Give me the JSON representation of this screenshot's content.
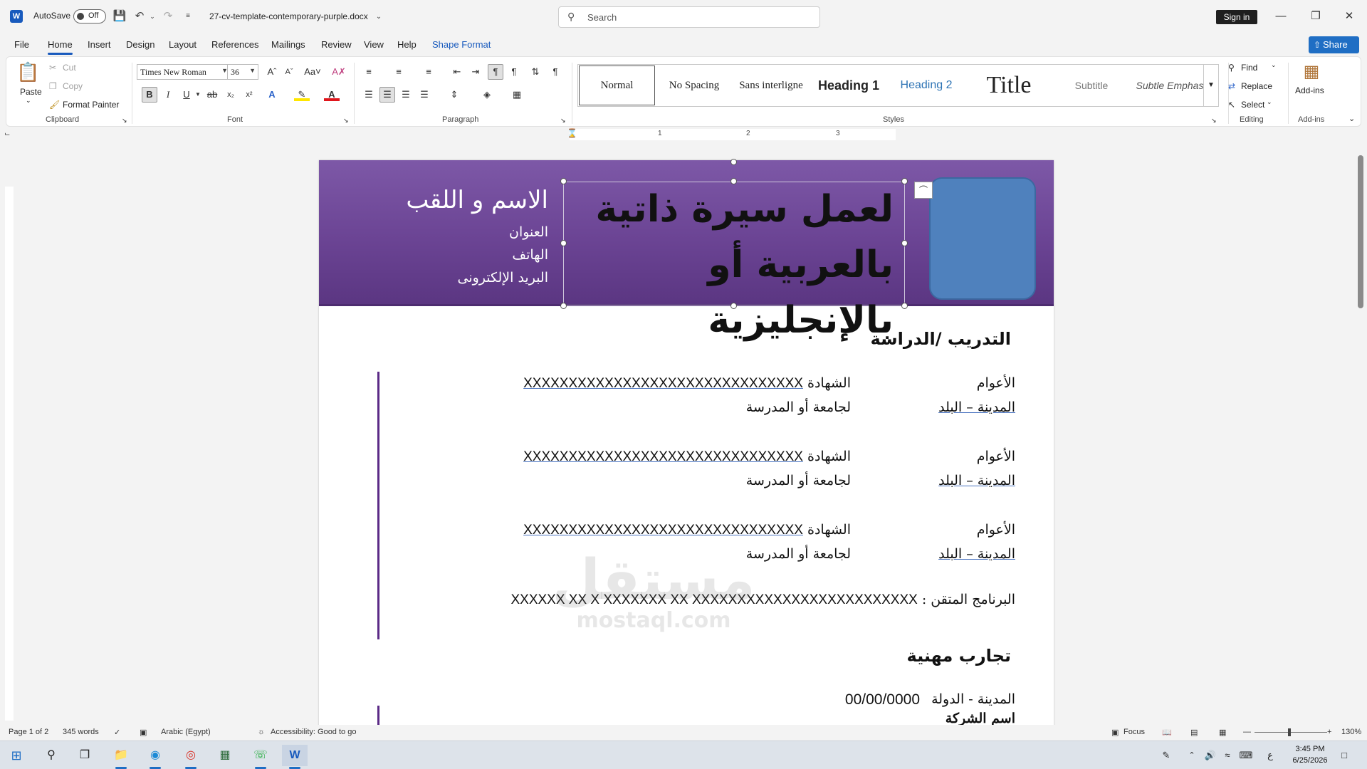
{
  "titlebar": {
    "autosave_label": "AutoSave",
    "autosave_state": "Off",
    "doc_title": "27-cv-template-contemporary-purple.docx",
    "search_placeholder": "Search",
    "signin": "Sign in"
  },
  "menu": [
    "File",
    "Home",
    "Insert",
    "Design",
    "Layout",
    "References",
    "Mailings",
    "Review",
    "View",
    "Help",
    "Shape Format"
  ],
  "share_label": "Share",
  "ribbon": {
    "clipboard": {
      "paste": "Paste",
      "cut": "Cut",
      "copy": "Copy",
      "format_painter": "Format Painter",
      "label": "Clipboard"
    },
    "font": {
      "name": "Times New Roman",
      "size": "36",
      "label": "Font"
    },
    "paragraph_label": "Paragraph",
    "styles": {
      "items": [
        "Normal",
        "No Spacing",
        "Sans interligne",
        "Heading 1",
        "Heading 2",
        "Title",
        "Subtitle",
        "Subtle Emphas"
      ],
      "label": "Styles"
    },
    "editing": {
      "find": "Find",
      "replace": "Replace",
      "select": "Select",
      "label": "Editing"
    },
    "addins": {
      "button": "Add-ins",
      "label": "Add-ins"
    }
  },
  "ruler": [
    "1",
    "2",
    "3"
  ],
  "document": {
    "title_lines": [
      "لعمل سيرة ذاتية",
      "بالعربية أو بالإنجليزية"
    ],
    "name": "الاسم و اللقب",
    "contact": [
      "العنوان",
      "الهاتف",
      "البريد الإلكترونى"
    ],
    "education_title": "التدريب /الدراسة",
    "education": [
      {
        "years": "الأعوام",
        "degree_label": "الشهادة",
        "degree_value": "XXXXXXXXXXXXXXXXXXXXXXXXXXXXXXX",
        "location": "المدينة – البلد",
        "school": "لجامعة أو المدرسة"
      },
      {
        "years": "الأعوام",
        "degree_label": "الشهادة",
        "degree_value": "XXXXXXXXXXXXXXXXXXXXXXXXXXXXXXX",
        "location": "المدينة – البلد",
        "school": "لجامعة أو المدرسة"
      },
      {
        "years": "الأعوام",
        "degree_label": "الشهادة",
        "degree_value": "XXXXXXXXXXXXXXXXXXXXXXXXXXXXXXX",
        "location": "المدينة – البلد",
        "school": "لجامعة أو المدرسة"
      }
    ],
    "software_label": "البرنامج المتقن :",
    "software_value": "XXXXXX XX X XXXXXXX XX XXXXXXXXXXXXXXXXXXXXXXXXX",
    "experience_title": "تجارب مهنية",
    "exp_location": "المدينة - الدولة",
    "exp_date": "00/00/0000",
    "exp_company": "اسم الشركة",
    "watermark_ar": "مستقل",
    "watermark_en": "mostaql.com"
  },
  "status": {
    "page": "Page 1 of 2",
    "words": "345 words",
    "language": "Arabic (Egypt)",
    "accessibility": "Accessibility: Good to go",
    "focus": "Focus",
    "zoom": "130%"
  },
  "taskbar": {
    "time": "3:45 PM",
    "date": "6/25/2026",
    "lang": "ع"
  }
}
